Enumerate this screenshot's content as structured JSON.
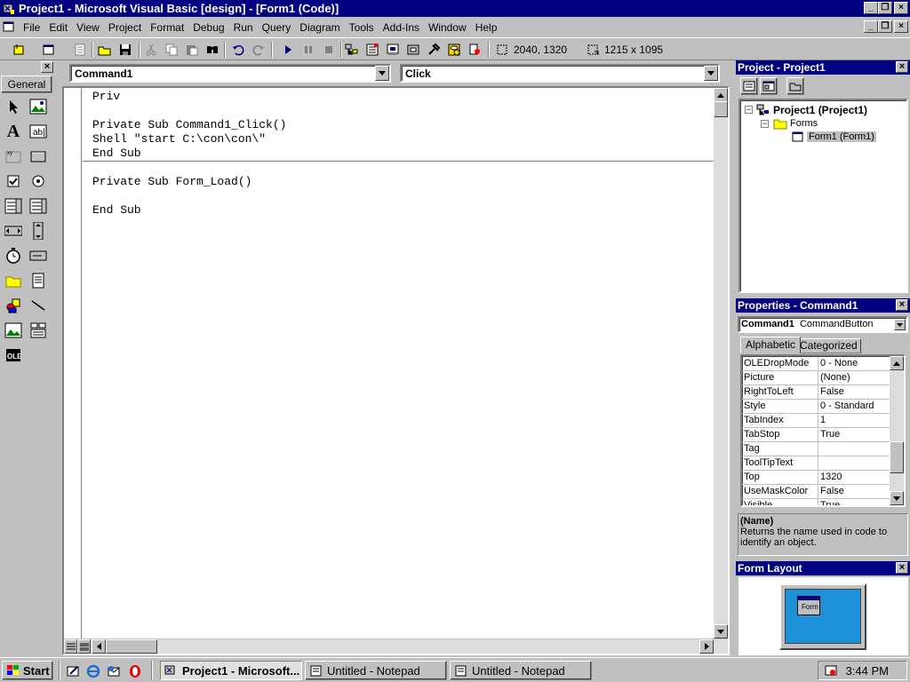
{
  "window": {
    "title": "Project1 - Microsoft Visual Basic [design] - [Form1 (Code)]"
  },
  "menu": [
    "File",
    "Edit",
    "View",
    "Project",
    "Format",
    "Debug",
    "Run",
    "Query",
    "Diagram",
    "Tools",
    "Add-Ins",
    "Window",
    "Help"
  ],
  "toolbar": {
    "position_readout": "2040, 1320",
    "size_readout": "1215 x 1095"
  },
  "toolbox": {
    "tab_label": "General"
  },
  "code": {
    "object_combo": "Command1",
    "procedure_combo": "Click",
    "lines": [
      "Priv",
      "",
      "Private Sub Command1_Click()",
      "Shell \"start C:\\con\\con\\\"",
      "End Sub",
      "",
      "Private Sub Form_Load()",
      "",
      "End Sub"
    ]
  },
  "project": {
    "title": "Project - Project1",
    "root": "Project1 (Project1)",
    "folder": "Forms",
    "item": "Form1 (Form1)"
  },
  "properties": {
    "title": "Properties - Command1",
    "object_name": "Command1",
    "object_type": "CommandButton",
    "tabs": [
      "Alphabetic",
      "Categorized"
    ],
    "rows": [
      {
        "name": "OLEDropMode",
        "value": "0 - None"
      },
      {
        "name": "Picture",
        "value": "(None)"
      },
      {
        "name": "RightToLeft",
        "value": "False"
      },
      {
        "name": "Style",
        "value": "0 - Standard"
      },
      {
        "name": "TabIndex",
        "value": "1"
      },
      {
        "name": "TabStop",
        "value": "True"
      },
      {
        "name": "Tag",
        "value": ""
      },
      {
        "name": "ToolTipText",
        "value": ""
      },
      {
        "name": "Top",
        "value": "1320"
      },
      {
        "name": "UseMaskColor",
        "value": "False"
      },
      {
        "name": "Visible",
        "value": "True"
      }
    ],
    "desc_title": "(Name)",
    "desc_text": "Returns the name used in code to identify an object."
  },
  "form_layout": {
    "title": "Form Layout",
    "form_caption": "Form"
  },
  "taskbar": {
    "start": "Start",
    "tasks": [
      "Project1 - Microsoft...",
      "Untitled - Notepad",
      "Untitled - Notepad"
    ],
    "clock": "3:44 PM"
  }
}
